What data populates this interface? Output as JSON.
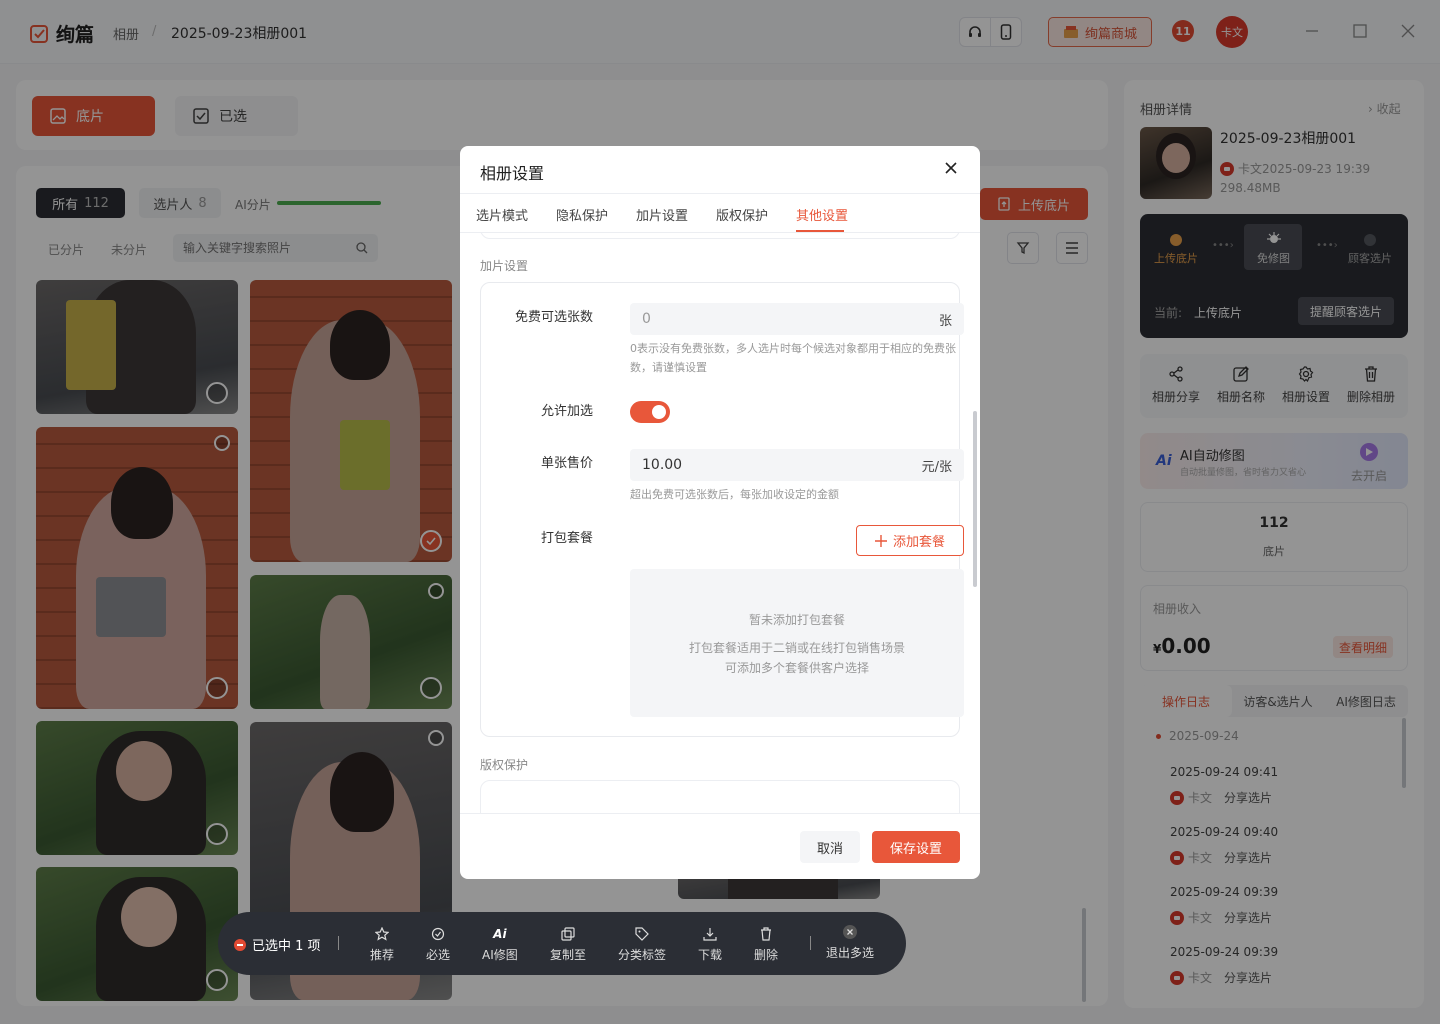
{
  "header": {
    "app_name": "绚篇",
    "breadcrumb_root": "相册",
    "breadcrumb_sep": "/",
    "album_name": "2025-09-23相册001",
    "mall_label": "绚篇商城",
    "notif_count": "11",
    "user_avatar": "卡文"
  },
  "tabs": {
    "raw": "底片",
    "selected": "已选"
  },
  "filters": {
    "all_label": "所有",
    "all_count": "112",
    "picker_label": "选片人",
    "picker_count": "8",
    "ai_label": "AI分片",
    "grouped": "已分片",
    "ungrouped": "未分片",
    "search_placeholder": "输入关键字搜索照片",
    "upload_label": "上传底片"
  },
  "action_bar": {
    "selected_text": "已选中 1 项",
    "items": [
      "推荐",
      "必选",
      "AI修图",
      "复制至",
      "分类标签",
      "下载",
      "删除"
    ],
    "exit_label": "退出多选"
  },
  "right_panel": {
    "title": "相册详情",
    "collapse": "收起",
    "album_name": "2025-09-23相册001",
    "owner_time": "卡文2025-09-23 19:39",
    "size": "298.48MB",
    "flow_steps": [
      "上传底片",
      "免修图",
      "顾客选片"
    ],
    "current_label": "当前:",
    "current_value": "上传底片",
    "remind_label": "提醒顾客选片",
    "actions": [
      "相册分享",
      "相册名称",
      "相册设置",
      "删除相册"
    ],
    "ai_badge": "Ai",
    "ai_title": "AI自动修图",
    "ai_subtitle": "自动批量修图，省时省力又省心",
    "ai_go": "去开启",
    "raw_count": "112",
    "raw_label": "底片",
    "income_label": "相册收入",
    "income_currency": "¥",
    "income_value": "0.00",
    "income_detail": "查看明细",
    "log_tabs": [
      "操作日志",
      "访客&选片人",
      "AI修图日志"
    ],
    "log_date": "2025-09-24",
    "logs": [
      {
        "time": "2025-09-24 09:41",
        "user": "卡文",
        "action": "分享选片"
      },
      {
        "time": "2025-09-24 09:40",
        "user": "卡文",
        "action": "分享选片"
      },
      {
        "time": "2025-09-24 09:39",
        "user": "卡文",
        "action": "分享选片"
      },
      {
        "time": "2025-09-24 09:39",
        "user": "卡文",
        "action": "分享选片"
      }
    ]
  },
  "modal": {
    "title": "相册设置",
    "tabs": [
      "选片模式",
      "隐私保护",
      "加片设置",
      "版权保护",
      "其他设置"
    ],
    "section_extra": "加片设置",
    "free_label": "免费可选张数",
    "free_value": "0",
    "free_unit": "张",
    "free_hint": "0表示没有免费张数，多人选片时每个候选对象都用于相应的免费张数，请谨慎设置",
    "allow_label": "允许加选",
    "price_label": "单张售价",
    "price_value": "10.00",
    "price_unit": "元/张",
    "price_hint": "超出免费可选张数后，每张加收设定的金额",
    "package_label": "打包套餐",
    "add_package": "添加套餐",
    "empty_title": "暂未添加打包套餐",
    "empty_desc1": "打包套餐适用于二销或在线打包销售场景",
    "empty_desc2": "可添加多个套餐供客户选择",
    "section_copyright": "版权保护",
    "cancel": "取消",
    "save": "保存设置"
  },
  "colors": {
    "accent": "#e8573a",
    "dark": "#2b2e35"
  }
}
